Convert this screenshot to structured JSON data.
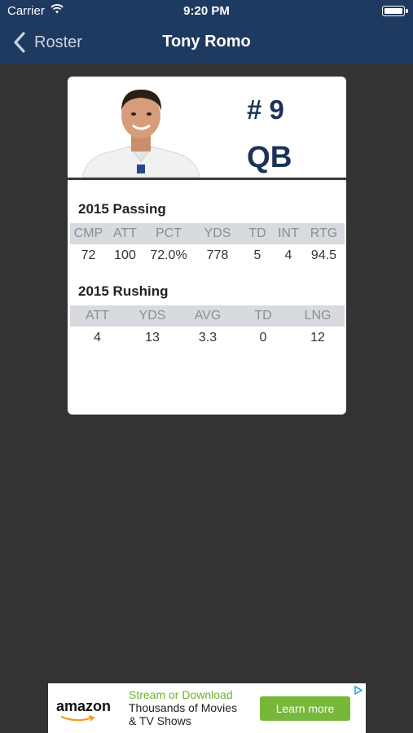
{
  "status_bar": {
    "carrier": "Carrier",
    "time": "9:20 PM"
  },
  "nav": {
    "back_label": "Roster",
    "title": "Tony Romo"
  },
  "player": {
    "number": "# 9",
    "position": "QB"
  },
  "passing": {
    "title": "2015 Passing",
    "headers": [
      "CMP",
      "ATT",
      "PCT",
      "YDS",
      "TD",
      "INT",
      "RTG"
    ],
    "values": [
      "72",
      "100",
      "72.0%",
      "778",
      "5",
      "4",
      "94.5"
    ]
  },
  "rushing": {
    "title": "2015 Rushing",
    "headers": [
      "ATT",
      "YDS",
      "AVG",
      "TD",
      "LNG"
    ],
    "values": [
      "4",
      "13",
      "3.3",
      "0",
      "12"
    ]
  },
  "ad": {
    "brand": "amazon",
    "line1": "Stream or Download",
    "line2": "Thousands of Movies",
    "line3": "& TV Shows",
    "button": "Learn more"
  },
  "colors": {
    "nav_bar": "#1f3a60",
    "background": "#333333",
    "accent_navy": "#1b3256",
    "ad_green": "#77b83a"
  }
}
